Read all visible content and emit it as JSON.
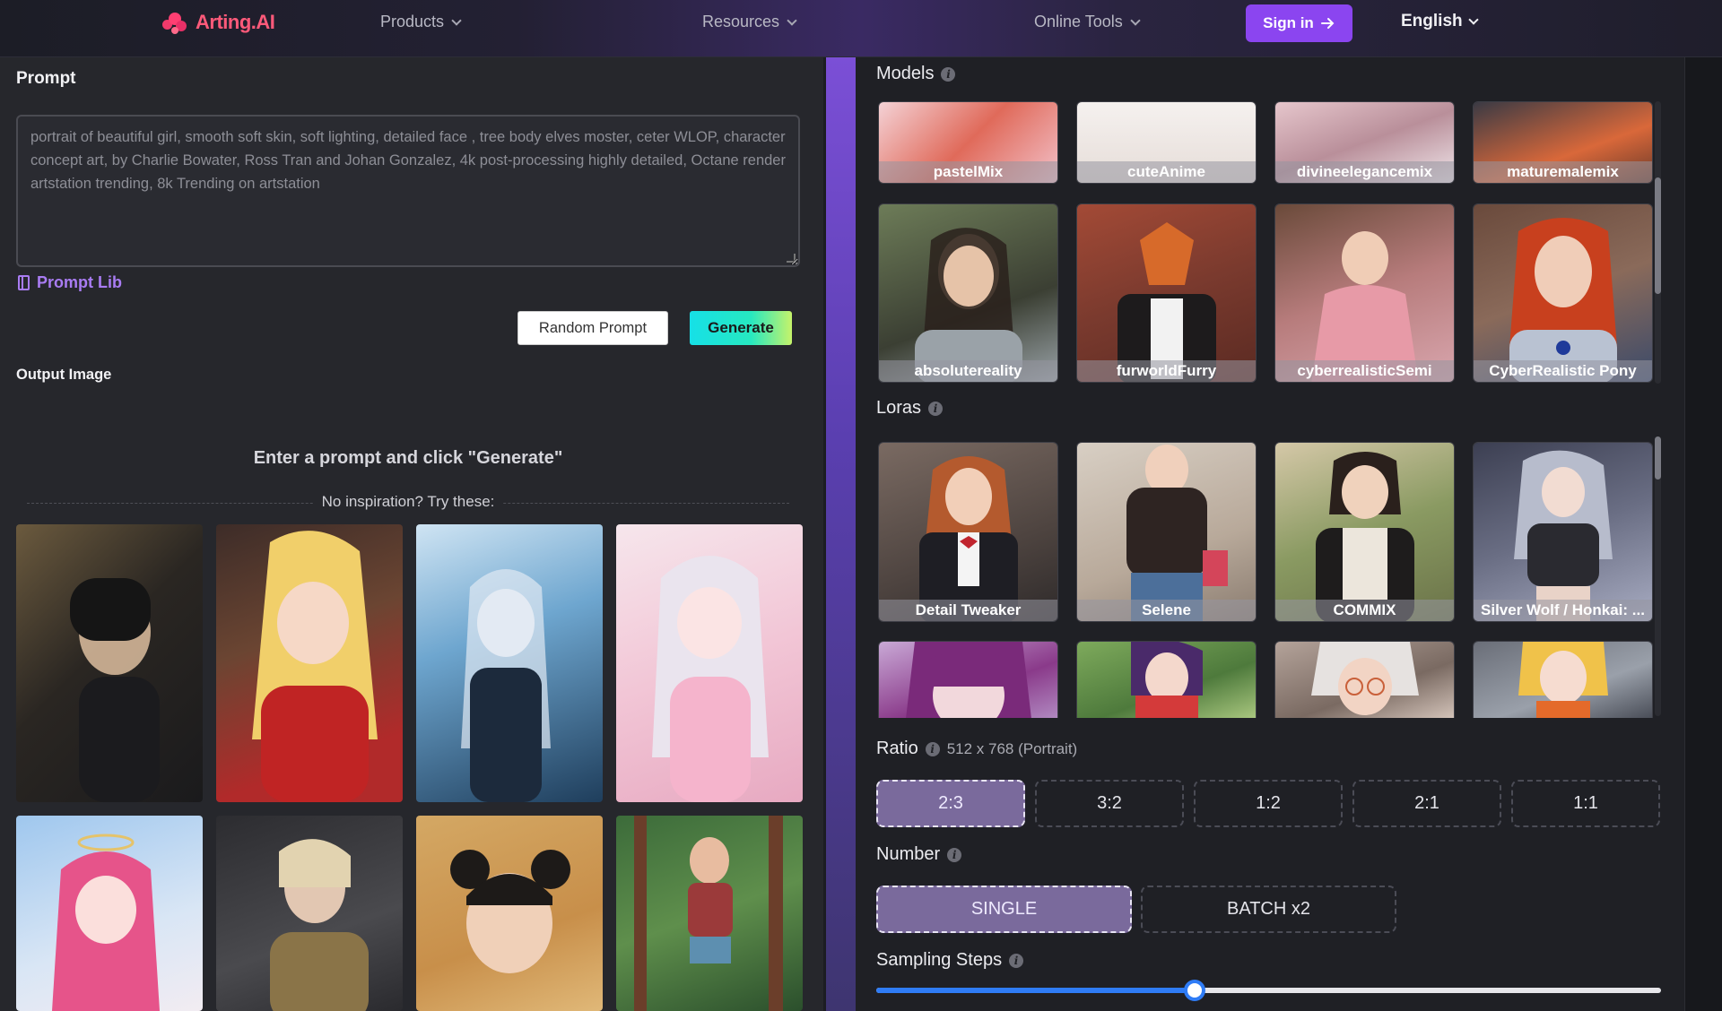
{
  "header": {
    "logo_text": "Arting.AI",
    "nav": [
      {
        "label": "Products"
      },
      {
        "label": "Resources"
      },
      {
        "label": "Online Tools"
      }
    ],
    "signin_label": "Sign in",
    "language": "English"
  },
  "left": {
    "prompt_title": "Prompt",
    "prompt_placeholder": "portrait of beautiful girl, smooth soft skin, soft lighting, detailed face , tree body elves moster, ceter WLOP, character concept art, by Charlie Bowater, Ross Tran and Johan Gonzalez, 4k post-processing highly detailed, Octane render artstation trending, 8k Trending on artstation",
    "prompt_lib": "Prompt Lib",
    "random_button": "Random Prompt",
    "generate_button": "Generate",
    "output_title": "Output Image",
    "enter_message": "Enter a prompt and click \"Generate\"",
    "inspiration": "No inspiration? Try these:"
  },
  "models": {
    "title": "Models",
    "items": [
      {
        "name": "pastelMix",
        "color": "#e7b7bd"
      },
      {
        "name": "cuteAnime",
        "color": "#efe9e6"
      },
      {
        "name": "divineelegancemix",
        "color": "#d9bcbf"
      },
      {
        "name": "maturemalemix",
        "color": "#6a5858"
      },
      {
        "name": "absolutereality",
        "color": "#5f6b58"
      },
      {
        "name": "furworldFurry",
        "color": "#8b4a3a"
      },
      {
        "name": "cyberrealisticSemi",
        "color": "#b98a8e"
      },
      {
        "name": "CyberRealistic Pony",
        "color": "#8a5a46"
      }
    ]
  },
  "loras": {
    "title": "Loras",
    "items": [
      {
        "name": "Detail Tweaker",
        "color": "#5b4d48"
      },
      {
        "name": "Selene",
        "color": "#8c7e72"
      },
      {
        "name": "COMMIX",
        "color": "#7a7864"
      },
      {
        "name": "Silver Wolf / Honkai: ...",
        "color": "#5e6476"
      },
      {
        "name": "",
        "color": "#b48fb6"
      },
      {
        "name": "",
        "color": "#7b8a5c"
      },
      {
        "name": "",
        "color": "#b8a49a"
      },
      {
        "name": "",
        "color": "#8a8c96"
      }
    ]
  },
  "ratio": {
    "title": "Ratio",
    "current": "512 x 768 (Portrait)",
    "options": [
      "2:3",
      "3:2",
      "1:2",
      "2:1",
      "1:1"
    ],
    "selected": "2:3"
  },
  "number": {
    "title": "Number",
    "options": [
      "SINGLE",
      "BATCH x2"
    ],
    "selected": "SINGLE"
  },
  "sampling": {
    "title": "Sampling Steps",
    "value_fraction": 0.406
  }
}
